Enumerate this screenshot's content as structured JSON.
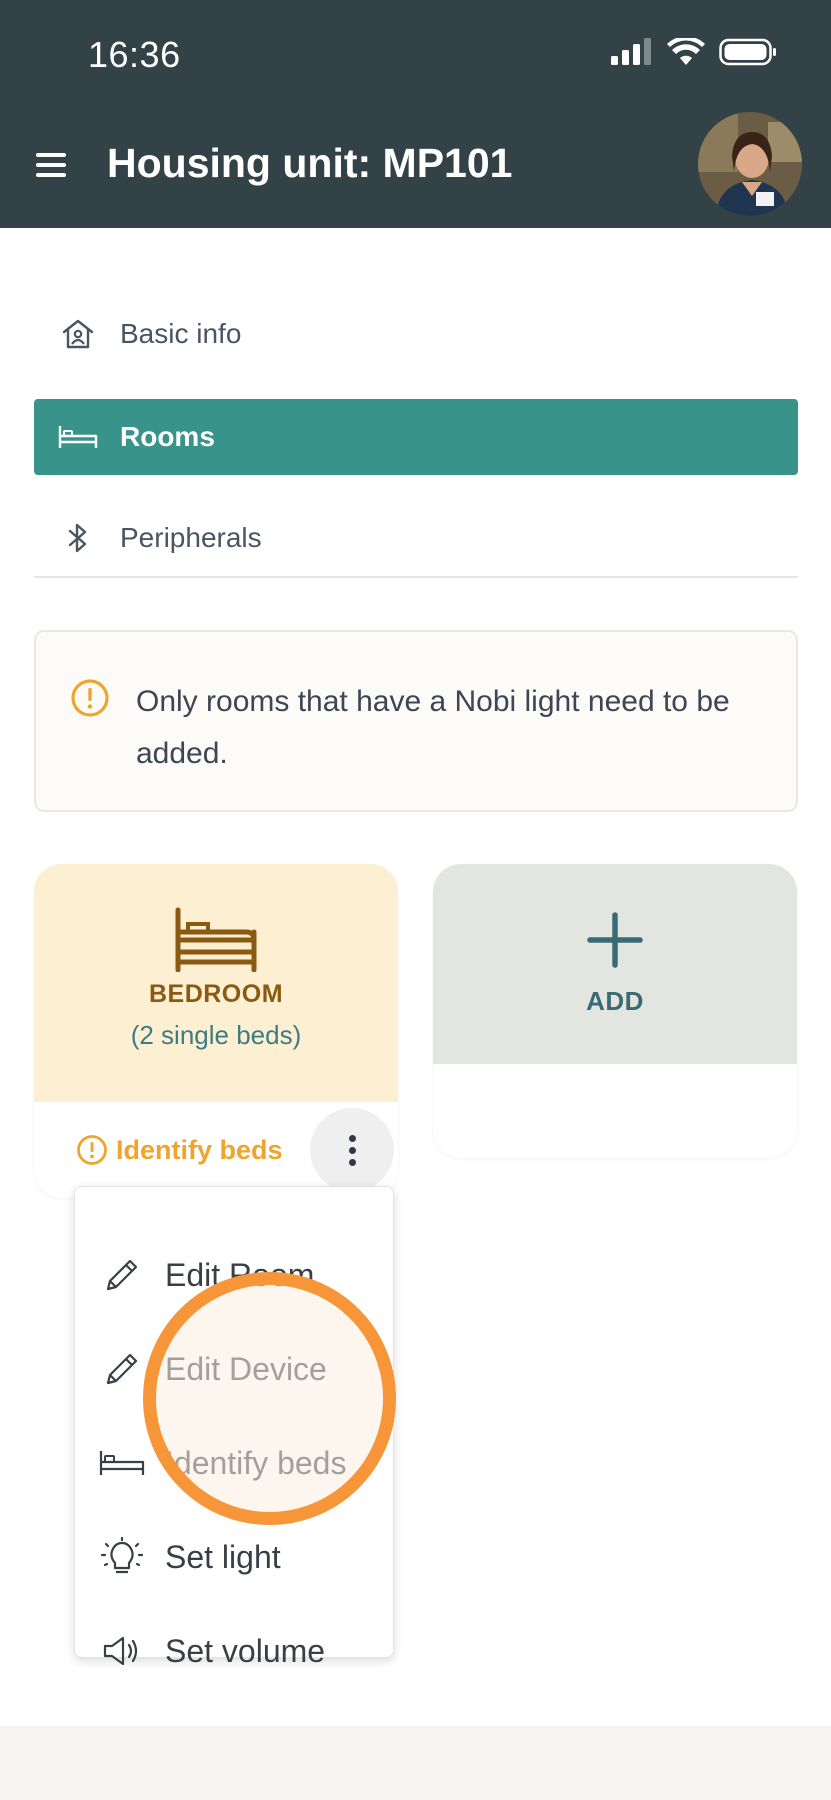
{
  "status_bar": {
    "time": "16:36"
  },
  "header": {
    "title": "Housing unit: MP101"
  },
  "nav": {
    "items": [
      {
        "label": "Basic info",
        "icon": "house-icon",
        "active": false
      },
      {
        "label": "Rooms",
        "icon": "bed-icon",
        "active": true
      },
      {
        "label": "Peripherals",
        "icon": "bluetooth-icon",
        "active": false
      }
    ]
  },
  "notice": {
    "text": "Only rooms that have a Nobi light need to be added.",
    "icon": "warning-circle-icon",
    "color": "#efa52d"
  },
  "rooms": [
    {
      "type": "BEDROOM",
      "detail": "(2 single beds)",
      "action": "Identify beds"
    }
  ],
  "add_card": {
    "label": "ADD"
  },
  "menu": {
    "items": [
      {
        "label": "Edit Room",
        "icon": "pencil-icon"
      },
      {
        "label": "Edit Device",
        "icon": "pencil-icon"
      },
      {
        "label": "Identify beds",
        "icon": "bed-icon"
      },
      {
        "label": "Set light",
        "icon": "lightbulb-icon"
      },
      {
        "label": "Set volume",
        "icon": "speaker-icon"
      }
    ]
  },
  "colors": {
    "header_bg": "#334247",
    "accent": "#38948a",
    "warning": "#efa52d",
    "highlight": "#f79638",
    "room_card_bg": "#fdefd2",
    "add_card_bg": "#e3e6e0"
  }
}
